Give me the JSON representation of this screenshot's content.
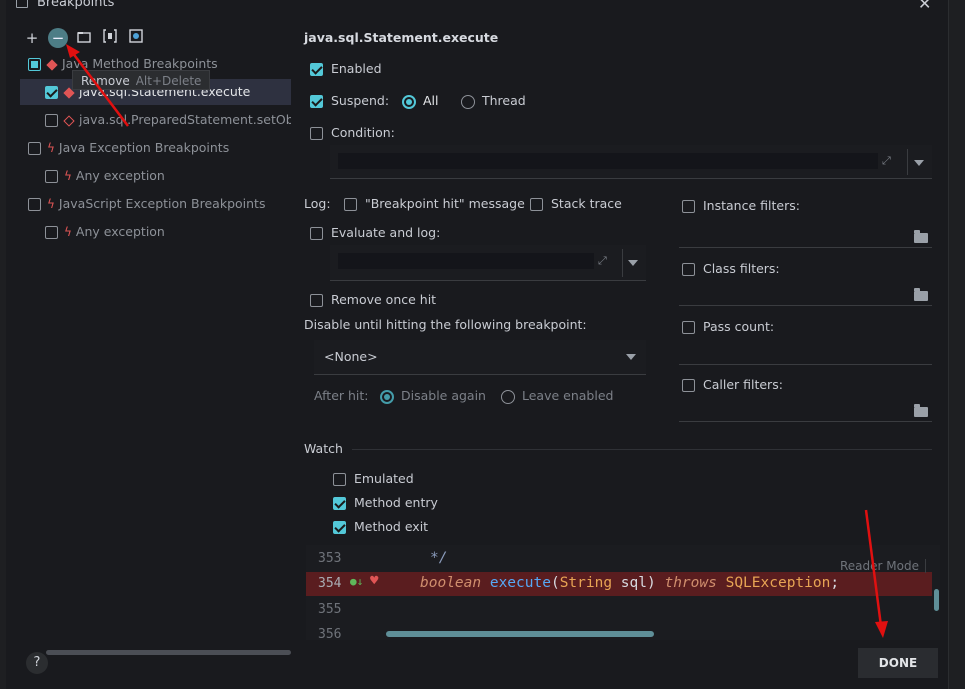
{
  "dialog": {
    "title": "Breakpoints",
    "close": "✕"
  },
  "toolbar": {
    "add": "+",
    "remove": "−",
    "tooltip_label": "Remove",
    "tooltip_shortcut": "Alt+Delete"
  },
  "tree": {
    "items": [
      {
        "label": "Java Method Breakpoints",
        "state": "partial"
      },
      {
        "label": "java.sql.Statement.execute",
        "state": "checked"
      },
      {
        "label": "java.sql.PreparedStatement.setObject",
        "state": "unchecked"
      },
      {
        "label": "Java Exception Breakpoints",
        "state": "unchecked"
      },
      {
        "label": "Any exception",
        "state": "unchecked"
      },
      {
        "label": "JavaScript Exception Breakpoints",
        "state": "unchecked"
      },
      {
        "label": "Any exception",
        "state": "unchecked"
      }
    ]
  },
  "details": {
    "header": "java.sql.Statement.execute",
    "enabled": "Enabled",
    "suspend": "Suspend:",
    "suspend_all": "All",
    "suspend_thread": "Thread",
    "condition": "Condition:",
    "log": "Log:",
    "log_message": "\"Breakpoint hit\" message",
    "stack_trace": "Stack trace",
    "evaluate_and_log": "Evaluate and log:",
    "remove_once_hit": "Remove once hit",
    "disable_until": "Disable until hitting the following breakpoint:",
    "none_option": "<None>",
    "after_hit": "After hit:",
    "disable_again": "Disable again",
    "leave_enabled": "Leave enabled",
    "instance_filters": "Instance filters:",
    "class_filters": "Class filters:",
    "pass_count": "Pass count:",
    "caller_filters": "Caller filters:",
    "watch": "Watch",
    "emulated": "Emulated",
    "method_entry": "Method entry",
    "method_exit": "Method exit"
  },
  "editor": {
    "lines": [
      {
        "num": "353",
        "text": "*/"
      },
      {
        "num": "354",
        "kw1": "boolean",
        "fn": "execute",
        "p1": "(",
        "cls1": "String",
        "p2": " sql) ",
        "kw2": "throws",
        "sp": " ",
        "cls2": "SQLException",
        "end": ";"
      },
      {
        "num": "355",
        "text": ""
      },
      {
        "num": "356",
        "text": ""
      }
    ],
    "reader_mode": "Reader Mode"
  },
  "footer": {
    "help": "?",
    "done": "DONE"
  },
  "colors": {
    "accent": "#53c8d8",
    "breakpoint_red": "#e05555",
    "annotation_arrow": "#e01010"
  }
}
